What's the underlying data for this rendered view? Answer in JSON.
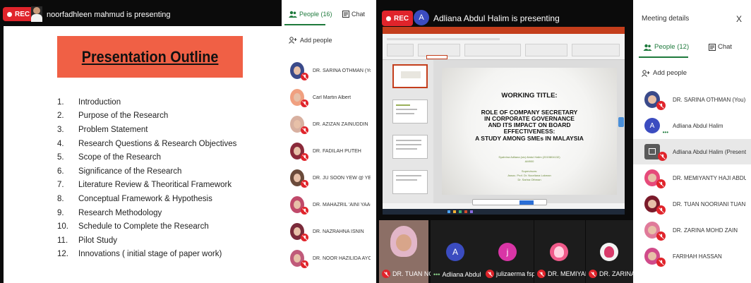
{
  "left_meeting": {
    "rec_label": "REC",
    "presenter_text": "noorfadhleen mahmud is presenting",
    "slide": {
      "title": "Presentation Outline",
      "items": [
        {
          "num": "1.",
          "text": "Introduction"
        },
        {
          "num": "2.",
          "text": "Purpose of the Research"
        },
        {
          "num": "3.",
          "text": "Problem Statement"
        },
        {
          "num": "4.",
          "text": "Research Questions & Research Objectives"
        },
        {
          "num": "5.",
          "text": "Scope of the Research"
        },
        {
          "num": "6.",
          "text": "Significance of the Research"
        },
        {
          "num": "7.",
          "text": "Literature Review & Theoritical Framework"
        },
        {
          "num": "8.",
          "text": "Conceptual Framework & Hypothesis"
        },
        {
          "num": "9.",
          "text": "Research Methodology"
        },
        {
          "num": "10.",
          "text": "Schedule to Complete the Research"
        },
        {
          "num": "11.",
          "text": "Pilot Study"
        },
        {
          "num": "12.",
          "text": "Innovations ( initial stage of paper work)"
        }
      ]
    }
  },
  "left_panel": {
    "people_tab": "People (16)",
    "chat_tab": "Chat",
    "add_people": "Add people",
    "participants": [
      {
        "name": "DR. SARINA OTHMAN (You)"
      },
      {
        "name": "Carl Martin Albert"
      },
      {
        "name": "DR. AZIZAN ZAINUDDIN"
      },
      {
        "name": "DR. FADILAH PUTEH"
      },
      {
        "name": "DR. JU SOON YEW @ YEW SO..."
      },
      {
        "name": "DR. MAHAZRIL 'AINI YAACOB"
      },
      {
        "name": "DR. NAZRAHNA ISNIN"
      },
      {
        "name": "DR. NOOR HAZILIDA AYOB"
      }
    ]
  },
  "right_meeting": {
    "rec_label": "REC",
    "presenter_initial": "A",
    "presenter_text": "Adliana Abdul Halim is presenting",
    "slide": {
      "working_title": "WORKING TITLE:",
      "title_lines": [
        "ROLE OF COMPANY SECRETARY",
        "IN CORPORATE GOVERNANCE",
        "AND ITS IMPACT ON BOARD",
        "EFFECTIVENESS:",
        "A STUDY AMONG SMEs IN MALAYSIA"
      ],
      "student_line": "Syahrina Adliana (sic) Abdul Halim (2019804132)",
      "program_line": "AM900",
      "supervisors_label": "Supervisors:",
      "supervisor_1": "Assoc. Prof. Dr. Noorliana Lokman",
      "supervisor_2": "Dr. Sarina Othman"
    },
    "tiles": [
      {
        "label": "DR. TUAN NO..."
      },
      {
        "label": "Adliana Abdul ...",
        "initial": "A"
      },
      {
        "label": "julizaerma fsp...",
        "initial": "j"
      },
      {
        "label": "DR. MEMIYAN..."
      },
      {
        "label": "DR. ZARINA M..."
      }
    ]
  },
  "right_panel": {
    "title": "Meeting details",
    "close": "X",
    "people_tab": "People (12)",
    "chat_tab": "Chat",
    "add_people": "Add people",
    "participants": [
      {
        "name": "DR. SARINA OTHMAN (You)"
      },
      {
        "name": "Adliana Abdul Halim",
        "initial": "A"
      },
      {
        "name": "Adliana Abdul Halim (Presenta..."
      },
      {
        "name": "DR. MEMIYANTY HAJI ABDUL ..."
      },
      {
        "name": "DR. TUAN NOORIANI TUAN IS..."
      },
      {
        "name": "DR. ZARINA MOHD ZAIN"
      },
      {
        "name": "FARIHAH HASSAN"
      }
    ]
  },
  "colors": {
    "accent_green": "#1e7a3c",
    "rec_red": "#e0242b",
    "slide_title_bar": "#f06045",
    "ppt_orange": "#c43e1c"
  }
}
